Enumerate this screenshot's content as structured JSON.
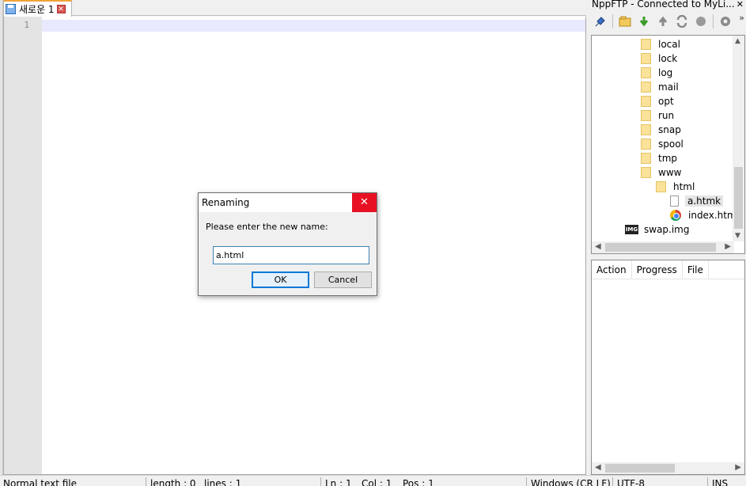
{
  "editor": {
    "tab_label": "새로운 1",
    "tab_close_glyph": "✕",
    "line_number": "1"
  },
  "ftp_panel": {
    "title": "NppFTP - Connected to MyLi...",
    "close_glyph": "✕",
    "more_glyph": "»",
    "toolbar_icons": [
      "connect-icon",
      "open-dir-icon",
      "download-icon",
      "upload-icon",
      "refresh-icon",
      "abort-icon",
      "settings-icon"
    ],
    "tree": [
      {
        "label": "local",
        "type": "folder"
      },
      {
        "label": "lock",
        "type": "folder"
      },
      {
        "label": "log",
        "type": "folder"
      },
      {
        "label": "mail",
        "type": "folder"
      },
      {
        "label": "opt",
        "type": "folder"
      },
      {
        "label": "run",
        "type": "folder"
      },
      {
        "label": "snap",
        "type": "folder"
      },
      {
        "label": "spool",
        "type": "folder"
      },
      {
        "label": "tmp",
        "type": "folder"
      },
      {
        "label": "www",
        "type": "folder"
      },
      {
        "label": "html",
        "type": "folder"
      },
      {
        "label": "a.htmk",
        "type": "file",
        "selected": true
      },
      {
        "label": "index.html",
        "type": "chrome-file"
      },
      {
        "label": "swap.img",
        "type": "image-file"
      }
    ],
    "img_badge": "IMG",
    "queue_columns": [
      "Action",
      "Progress",
      "File"
    ]
  },
  "status_bar": {
    "file_type": "Normal text file",
    "length": "length : 0",
    "lines": "lines : 1",
    "ln": "Ln : 1",
    "col": "Col : 1",
    "pos": "Pos : 1",
    "eol": "Windows (CR LF)",
    "encoding": "UTF-8",
    "mode": "INS"
  },
  "dialog": {
    "title": "Renaming",
    "close_glyph": "✕",
    "prompt": "Please enter the new name:",
    "input_value": "a.html",
    "ok_label": "OK",
    "cancel_label": "Cancel"
  },
  "colors": {
    "accent": "#0078d7",
    "dialog_close": "#e81123",
    "current_line": "#e8e8ff",
    "tab_accent": "#f3a23a"
  }
}
